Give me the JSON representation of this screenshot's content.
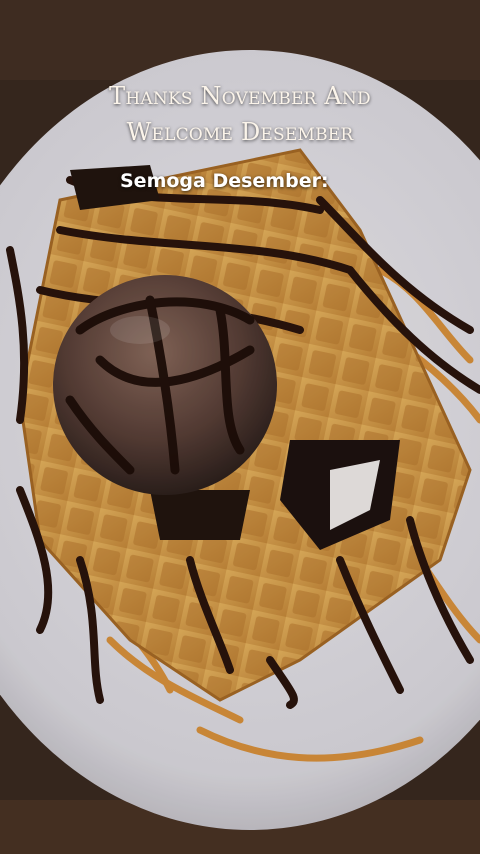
{
  "overlay": {
    "title_line1": "Thanks November And",
    "title_line2": "Welcome Desember",
    "subtitle": "Semoga Desember:"
  },
  "colors": {
    "plate": "#e4e2e8",
    "waffle": "#d9a24e",
    "chocolate": "#2a140c",
    "caramel": "#d98a2a",
    "ice_cream": "#5a4038",
    "table": "#3a2a20"
  }
}
